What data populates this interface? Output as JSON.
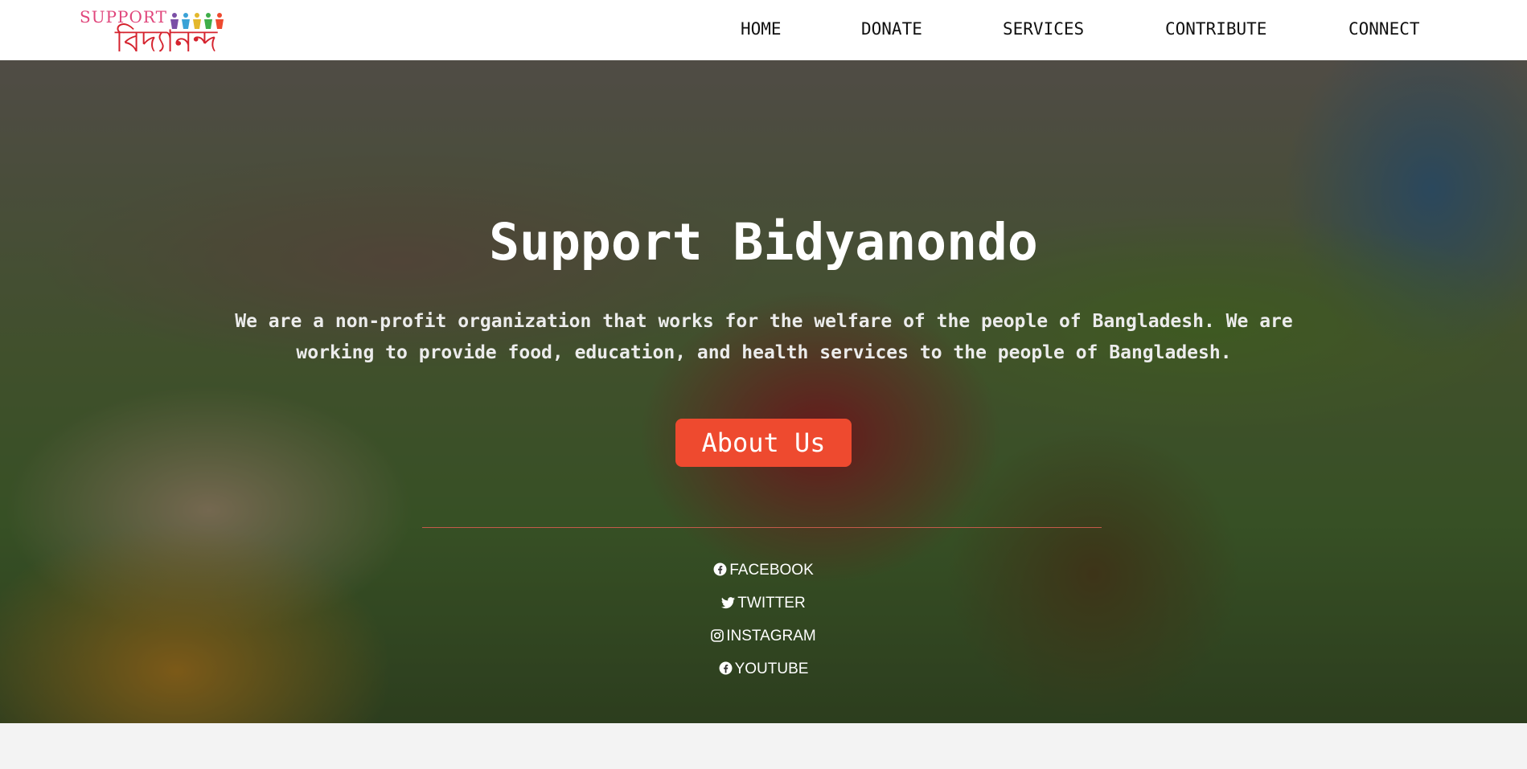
{
  "brand": {
    "logo_top": "SUPPORT",
    "logo_main": "বিদ্যানন্দ"
  },
  "nav": {
    "items": [
      {
        "label": "HOME"
      },
      {
        "label": "DONATE"
      },
      {
        "label": "SERVICES"
      },
      {
        "label": "CONTRIBUTE"
      },
      {
        "label": "CONNECT"
      }
    ]
  },
  "hero": {
    "title": "Support Bidyanondo",
    "description": "We are a non-profit organization that works for the welfare of the people of Bangladesh. We are working to provide food, education, and health services to the people of Bangladesh.",
    "button_label": "About Us"
  },
  "social": {
    "links": [
      {
        "label": "FACEBOOK",
        "icon": "facebook-icon"
      },
      {
        "label": "TWITTER",
        "icon": "twitter-icon"
      },
      {
        "label": "INSTAGRAM",
        "icon": "instagram-icon"
      },
      {
        "label": "YOUTUBE",
        "icon": "facebook-icon"
      }
    ]
  },
  "colors": {
    "accent_button": "#ee4a2f",
    "nav_text": "#111111",
    "logo_pink": "#e0457b",
    "logo_red": "#d5232e",
    "hero_overlay": "rgba(0,0,0,0.42)"
  }
}
